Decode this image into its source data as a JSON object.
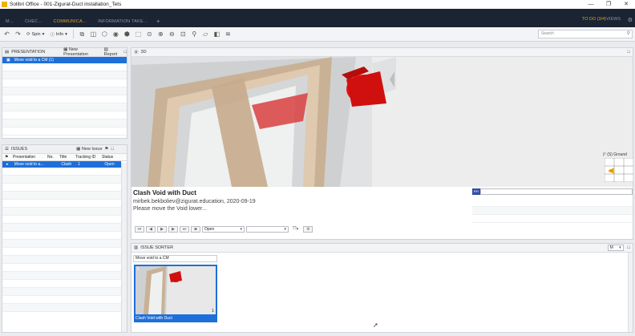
{
  "window": {
    "title": "Solibri Office - 001-Zigurat-Duct installation_Tets",
    "minimize": "—",
    "maximize": "❐",
    "close": "✕"
  },
  "tabs": [
    {
      "label": "M..."
    },
    {
      "label": "CHEC..."
    },
    {
      "label": "COMMUNICA..."
    },
    {
      "label": "INFORMATION TAKE..."
    }
  ],
  "tab_add": "+",
  "header_right": {
    "todo": "TO DO (3/4)",
    "views": "VIEWS"
  },
  "toolbar": {
    "spin_label": "Spin",
    "info_label": "Info",
    "search_placeholder": "Search",
    "icons": [
      "undo-icon",
      "redo-icon",
      "spin-icon",
      "info-icon",
      "selection-basket-icon",
      "hide-icon",
      "isolate-icon",
      "visibility-icon",
      "view-cube-icon",
      "fit-icon",
      "zoom-fit-icon",
      "zoom-in-icon",
      "zoom-out-icon",
      "zoom-window-icon",
      "measure-icon",
      "section-icon",
      "slicer-icon",
      "layers-icon"
    ]
  },
  "presentation_panel": {
    "title": "PRESENTATION",
    "new_presentation_label": "New Presentation",
    "report_label": "Report",
    "selected_item": "Move void to a CM (1)"
  },
  "issues_panel": {
    "title": "ISSUES",
    "new_issue_label": "New Issue",
    "columns": [
      "Presentation",
      "No.",
      "Title",
      "Tracking ID",
      "Status"
    ],
    "rows": [
      {
        "presentation": "Move void to a...",
        "no": "",
        "title": "Clash",
        "tracking_id": "1",
        "status": "Open"
      }
    ]
  },
  "view3d": {
    "title": "3D",
    "ground_label": "(S) Ground"
  },
  "issue_detail": {
    "title": "Clash Void with Duct",
    "author_line": "mirbek.bekboliev@zigurat.education, 2020-09-19",
    "description": "Please move the Void lower...",
    "status_value": "Open",
    "second_select": "",
    "badge": "RFI"
  },
  "issue_sorter": {
    "title": "ISSUE SORTER",
    "field_value": "Move void to a CM",
    "thumb_number": "1",
    "thumb_count": "1",
    "thumb_caption": "Clash Void with Duct",
    "size_select": "M"
  }
}
